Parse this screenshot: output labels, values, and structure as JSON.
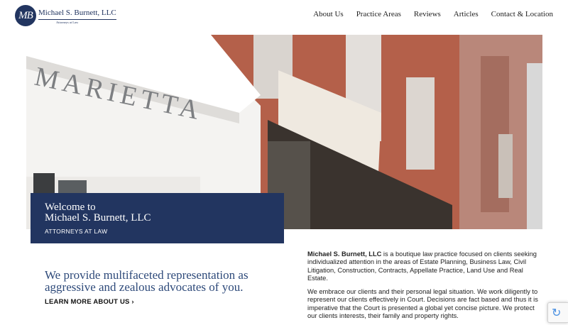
{
  "header": {
    "logo": {
      "mark": "MB",
      "name": "Michael S. Burnett, LLC",
      "subtitle": "Attorneys at Law"
    },
    "nav": [
      {
        "label": "About Us"
      },
      {
        "label": "Practice Areas"
      },
      {
        "label": "Reviews"
      },
      {
        "label": "Articles"
      },
      {
        "label": "Contact & Location"
      }
    ]
  },
  "hero": {
    "sign_text": "MARIETTA",
    "welcome_line1": "Welcome to",
    "welcome_line2": "Michael S. Burnett, LLC",
    "welcome_sub": "ATTORNEYS AT LAW"
  },
  "tagline": "We provide multifaceted representation as aggressive and zealous advocates of you.",
  "learn_more": "LEARN MORE ABOUT US ›",
  "intro": {
    "p1_bold": "Michael S. Burnett, LLC",
    "p1_rest": " is a boutique law practice focused on clients seeking individualized attention in the areas of Estate Planning, Business Law, Civil Litigation, Construction, Contracts, Appellate Practice, Land Use and Real Estate.",
    "p2": "We embrace our clients and their personal legal situation. We work diligently to represent our clients effectively in Court. Decisions are fact based and thus it is imperative that the Court is presented a global yet concise picture. We protect our clients interests, their family and property rights."
  },
  "colors": {
    "navy": "#223560",
    "tagline_blue": "#2e4a7a"
  },
  "icons": {
    "recaptcha": "recaptcha-icon"
  }
}
